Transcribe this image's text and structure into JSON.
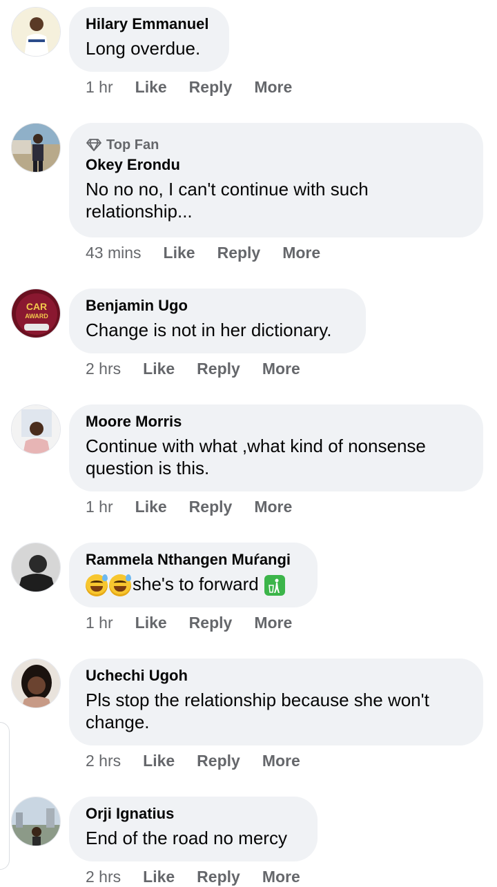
{
  "labels": {
    "like": "Like",
    "reply": "Reply",
    "more": "More"
  },
  "comments": [
    {
      "name": "Hilary Emmanuel",
      "text": "Long overdue.",
      "time": "1 hr"
    },
    {
      "badge": "Top Fan",
      "name": "Okey Erondu",
      "text": "No no no, I can't continue with such relationship...",
      "time": "43 mins"
    },
    {
      "name": "Benjamin Ugo",
      "text": "Change is not in her dictionary.",
      "time": "2 hrs",
      "avatar_text": "CAR AWARD"
    },
    {
      "name": "Moore Morris",
      "text": "Continue with what ,what kind of nonsense question is this.",
      "time": "1 hr"
    },
    {
      "name": "Rammela Nthangen Muŕangi",
      "text": "she's to forward",
      "emojis": [
        "grinning-sweat-emoji",
        "grinning-sweat-emoji",
        "litter-in-bin-emoji"
      ],
      "time": "1 hr"
    },
    {
      "name": "Uchechi Ugoh",
      "text": "Pls stop the relationship because she won't change.",
      "time": "2 hrs"
    },
    {
      "name": "Orji Ignatius",
      "text": "End of the road no mercy",
      "time": "2 hrs"
    }
  ],
  "colors": {
    "bubble": "#f0f2f5",
    "meta": "#65676b",
    "text": "#050505"
  }
}
